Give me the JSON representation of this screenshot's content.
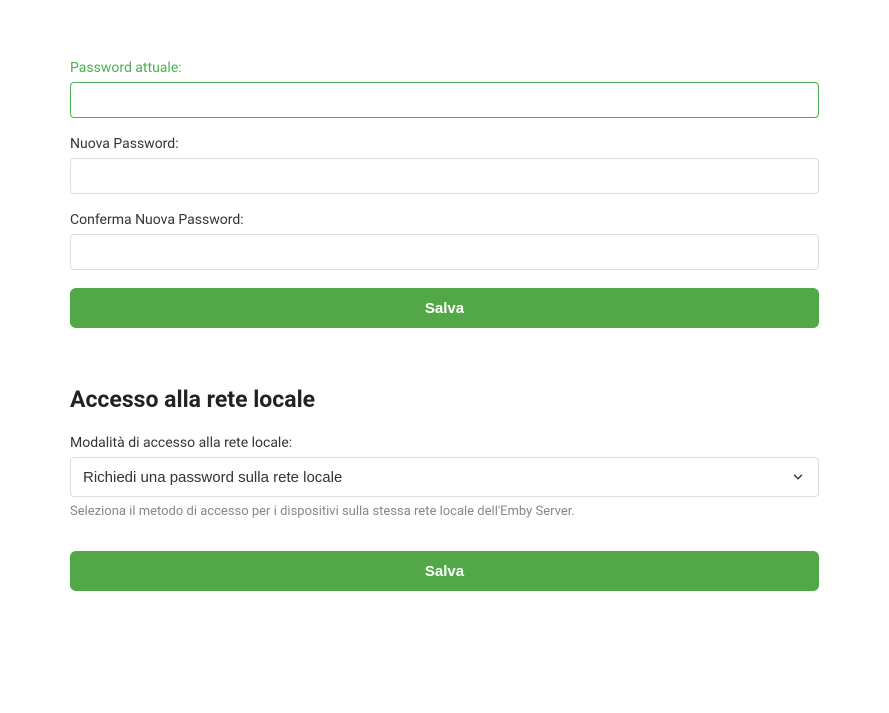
{
  "password_section": {
    "current_password_label": "Password attuale:",
    "current_password_value": "",
    "new_password_label": "Nuova Password:",
    "new_password_value": "",
    "confirm_password_label": "Conferma Nuova Password:",
    "confirm_password_value": "",
    "save_button": "Salva"
  },
  "local_network_section": {
    "heading": "Accesso alla rete locale",
    "mode_label": "Modalità di accesso alla rete locale:",
    "mode_selected": "Richiedi una password sulla rete locale",
    "help_text": "Seleziona il metodo di accesso per i dispositivi sulla stessa rete locale dell'Emby Server.",
    "save_button": "Salva"
  }
}
